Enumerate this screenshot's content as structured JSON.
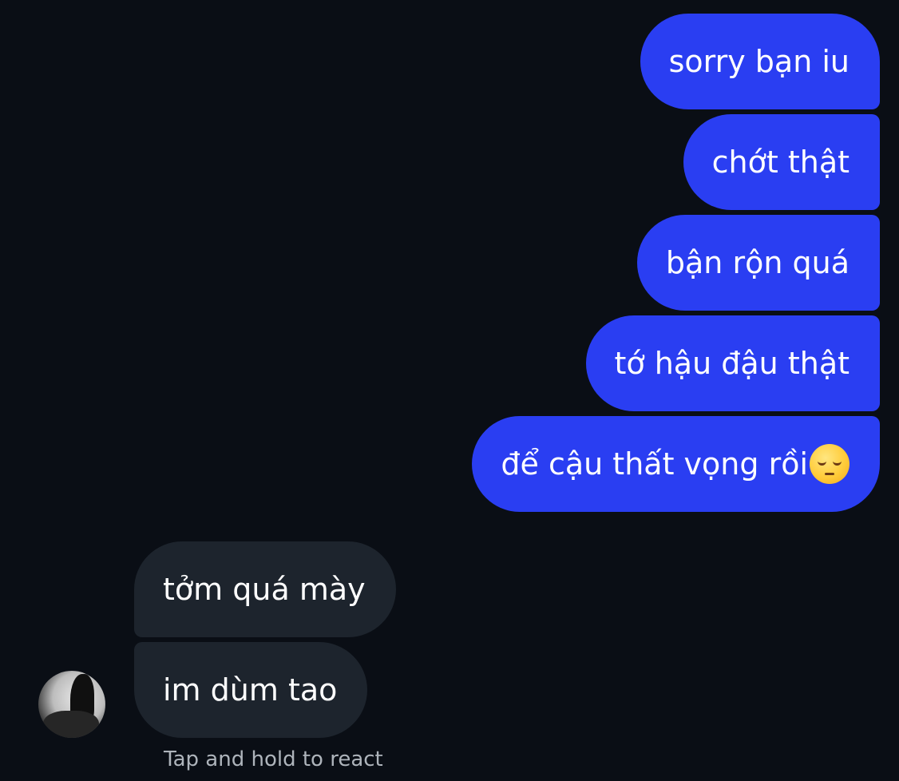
{
  "colors": {
    "background": "#0a0e15",
    "sent_bubble": "#2a3ef2",
    "received_bubble": "#1d242d",
    "text": "#ffffff",
    "hint_text": "#aeb4bb"
  },
  "sent_messages": [
    {
      "text": "sorry bạn iu"
    },
    {
      "text": "chớt thật"
    },
    {
      "text": "bận rộn quá"
    },
    {
      "text": "tớ hậu đậu thật"
    },
    {
      "text": "để cậu thất vọng rồi",
      "emoji": "pensive-face-emoji"
    }
  ],
  "received_messages": [
    {
      "text": "tởm quá mày"
    },
    {
      "text": "im dùm tao"
    }
  ],
  "contact": {
    "avatar_icon": "profile-photo"
  },
  "hint": "Tap and hold to react"
}
